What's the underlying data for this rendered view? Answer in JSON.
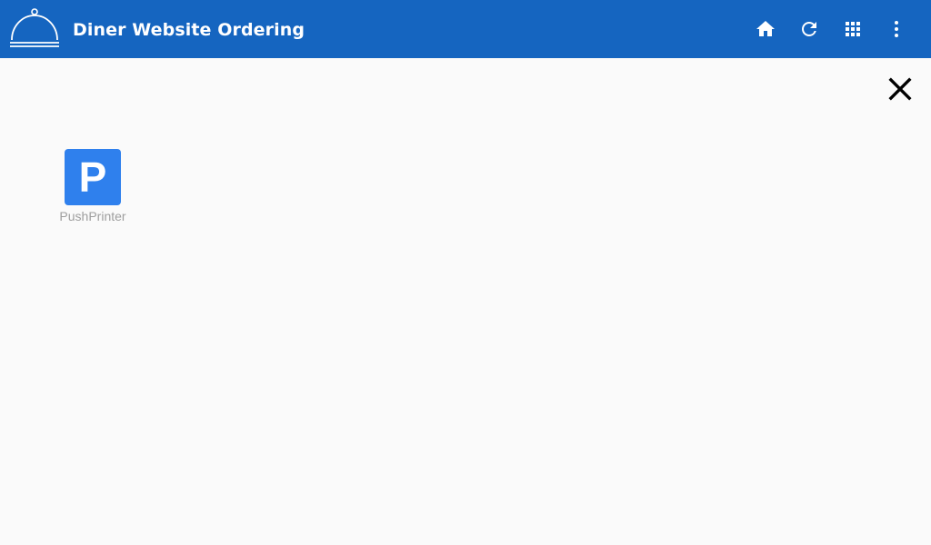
{
  "appbar": {
    "title": "Diner Website Ordering",
    "background": "#1565c0",
    "logo_icon": "cloche-icon",
    "actions": [
      {
        "name": "home",
        "icon": "home-icon"
      },
      {
        "name": "refresh",
        "icon": "refresh-icon"
      },
      {
        "name": "apps",
        "icon": "grid-icon"
      },
      {
        "name": "more",
        "icon": "more-vert-icon"
      }
    ]
  },
  "dialog": {
    "close_icon": "close-icon"
  },
  "apps": [
    {
      "letter": "P",
      "label": "PushPrinter",
      "color": "#2f80ed"
    }
  ]
}
